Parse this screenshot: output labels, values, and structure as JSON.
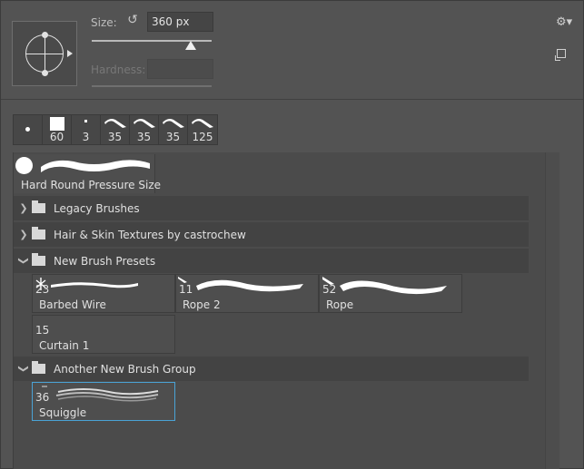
{
  "options": {
    "size_label": "Size:",
    "size_value": "360 px",
    "size_slider_fraction": 0.8,
    "hardness_label": "Hardness:",
    "hardness_value": ""
  },
  "icons": {
    "reset": "reset-icon",
    "settings": "gear-icon",
    "new_preset": "new-preset-icon"
  },
  "recent_brushes": [
    {
      "shape": "dot",
      "size": ""
    },
    {
      "shape": "square",
      "size": "60"
    },
    {
      "shape": "small-square",
      "size": "3"
    },
    {
      "shape": "stroke",
      "size": "35"
    },
    {
      "shape": "stroke",
      "size": "35"
    },
    {
      "shape": "stroke",
      "size": "35"
    },
    {
      "shape": "stroke",
      "size": "125"
    }
  ],
  "current_brush": {
    "name": "Hard Round Pressure Size"
  },
  "groups": [
    {
      "label": "Legacy Brushes",
      "expanded": false
    },
    {
      "label": "Hair & Skin Textures by castrochew",
      "expanded": false
    },
    {
      "label": "New Brush Presets",
      "expanded": true
    },
    {
      "label": "Another New Brush Group",
      "expanded": true
    }
  ],
  "new_brush_presets": [
    {
      "size": "23",
      "name": "Barbed Wire"
    },
    {
      "size": "11",
      "name": "Rope 2"
    },
    {
      "size": "52",
      "name": "Rope"
    },
    {
      "size": "15",
      "name": "Curtain 1"
    }
  ],
  "another_group_presets": [
    {
      "size": "36",
      "name": "Squiggle",
      "selected": true
    }
  ],
  "colors": {
    "panel_bg": "#535353",
    "selection_border": "#4aa3d6"
  }
}
